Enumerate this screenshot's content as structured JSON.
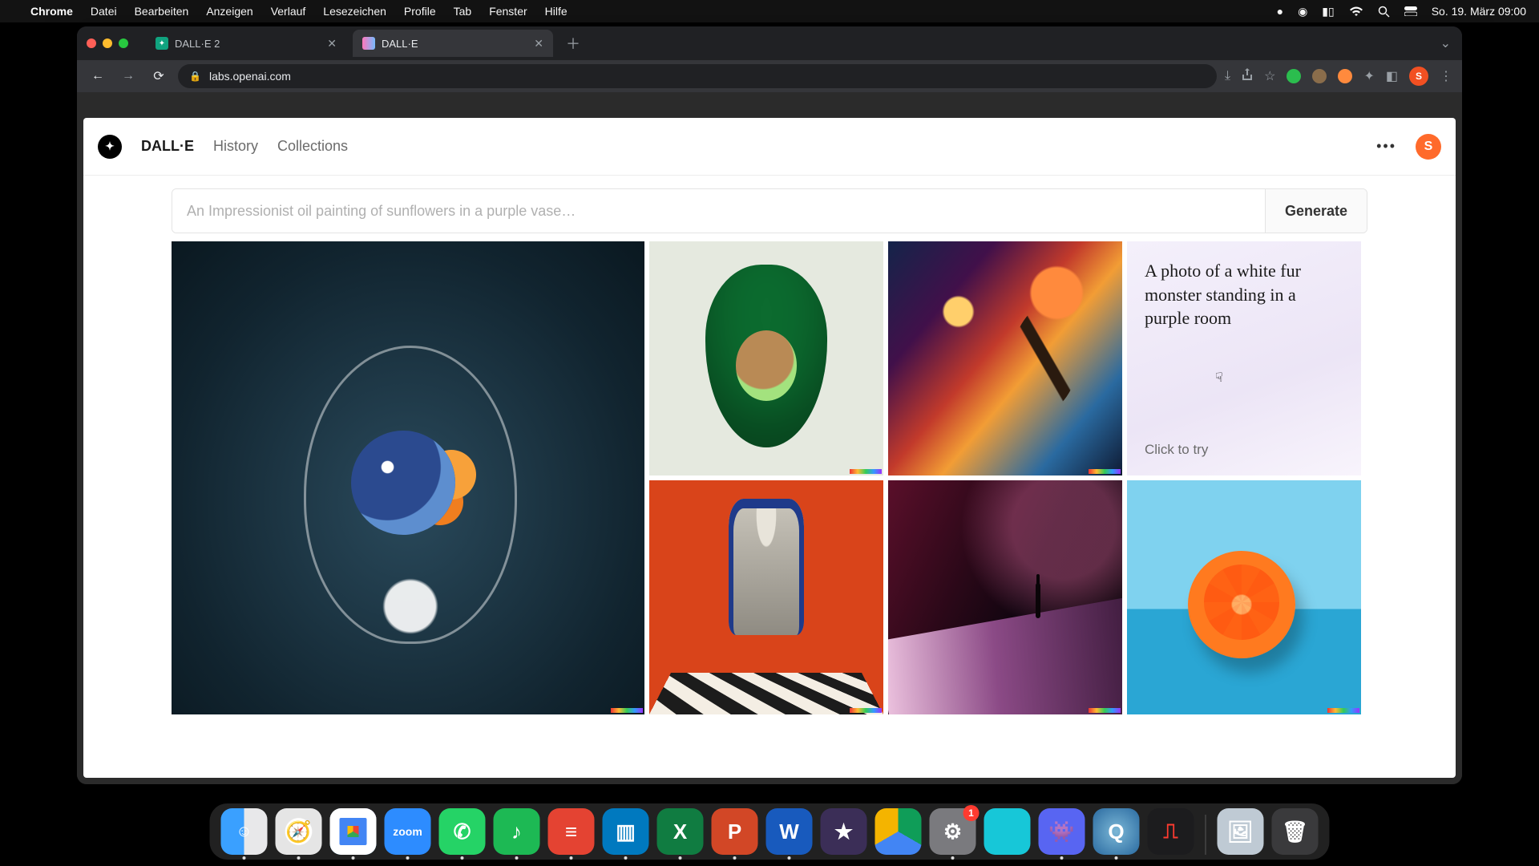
{
  "menubar": {
    "app": "Chrome",
    "items": [
      "Datei",
      "Bearbeiten",
      "Anzeigen",
      "Verlauf",
      "Lesezeichen",
      "Profile",
      "Tab",
      "Fenster",
      "Hilfe"
    ],
    "clock": "So. 19. März  09:00"
  },
  "browser": {
    "tabs": [
      {
        "title": "DALL·E 2",
        "active": false
      },
      {
        "title": "DALL·E",
        "active": true
      }
    ],
    "url": "labs.openai.com",
    "avatar_initial": "S"
  },
  "page": {
    "nav": {
      "brand": "DALL·E",
      "history": "History",
      "collections": "Collections"
    },
    "avatar_initial": "S",
    "prompt": {
      "placeholder": "An Impressionist oil painting of sunflowers in a purple vase…",
      "value": "",
      "generate": "Generate"
    },
    "suggestion": {
      "text": "A photo of a white fur monster standing in a purple room",
      "cta": "Click to try"
    },
    "tiles": [
      {
        "name": "fishbowl-render"
      },
      {
        "name": "avocado-armchair"
      },
      {
        "name": "nebula-dunk-painting"
      },
      {
        "name": "robot-chess-painting"
      },
      {
        "name": "neon-dunes-silhouette"
      },
      {
        "name": "orange-on-blue"
      }
    ]
  },
  "dock": {
    "settings_badge": "1"
  }
}
